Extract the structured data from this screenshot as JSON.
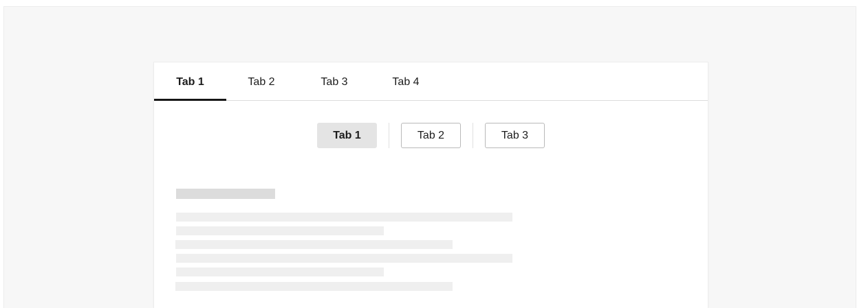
{
  "tabs": {
    "items": [
      {
        "label": "Tab 1",
        "active": true
      },
      {
        "label": "Tab 2",
        "active": false
      },
      {
        "label": "Tab 3",
        "active": false
      },
      {
        "label": "Tab 4",
        "active": false
      }
    ]
  },
  "segmented": {
    "items": [
      {
        "label": "Tab 1",
        "active": true
      },
      {
        "label": "Tab 2",
        "active": false
      },
      {
        "label": "Tab 3",
        "active": false
      }
    ]
  },
  "colors": {
    "page_background": "#f7f7f7",
    "card_background": "#ffffff",
    "active_underline": "#161616",
    "active_segment": "#e4e4e4",
    "skeleton_heading": "#dcdcdc",
    "skeleton_line": "#efefef"
  }
}
